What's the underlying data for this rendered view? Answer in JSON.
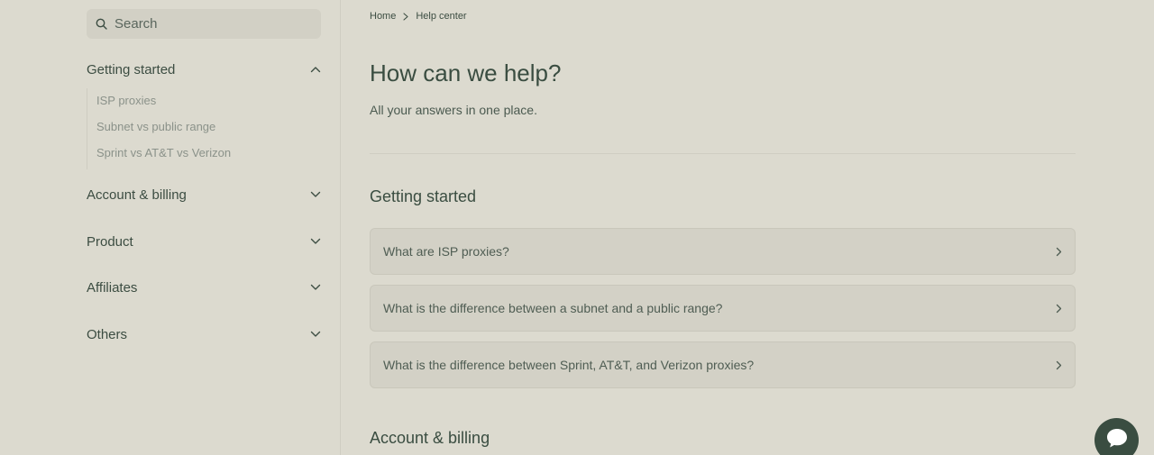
{
  "search": {
    "placeholder": "Search",
    "icon": "search-icon"
  },
  "sidebar": {
    "sections": [
      {
        "label": "Getting started",
        "expanded": true,
        "icon": "chevron-up-icon",
        "items": [
          "ISP proxies",
          "Subnet vs public range",
          "Sprint vs AT&T vs Verizon"
        ]
      },
      {
        "label": "Account & billing",
        "expanded": false,
        "icon": "chevron-down-icon"
      },
      {
        "label": "Product",
        "expanded": false,
        "icon": "chevron-down-icon"
      },
      {
        "label": "Affiliates",
        "expanded": false,
        "icon": "chevron-down-icon"
      },
      {
        "label": "Others",
        "expanded": false,
        "icon": "chevron-down-icon"
      }
    ]
  },
  "breadcrumb": {
    "items": [
      "Home",
      "Help center"
    ],
    "separator_icon": "chevron-right-icon"
  },
  "main": {
    "title": "How can we help?",
    "subtitle": "All your answers in one place.",
    "sections": [
      {
        "heading": "Getting started",
        "questions": [
          "What are ISP proxies?",
          "What is the difference between a subnet and a public range?",
          "What is the difference between Sprint, AT&T, and Verizon proxies?"
        ]
      },
      {
        "heading": "Account & billing"
      }
    ]
  },
  "chat": {
    "icon": "chat-bubble-icon"
  },
  "colors": {
    "background": "#dcdacf",
    "accent": "#3a4d41",
    "card": "#d3d1c6"
  }
}
